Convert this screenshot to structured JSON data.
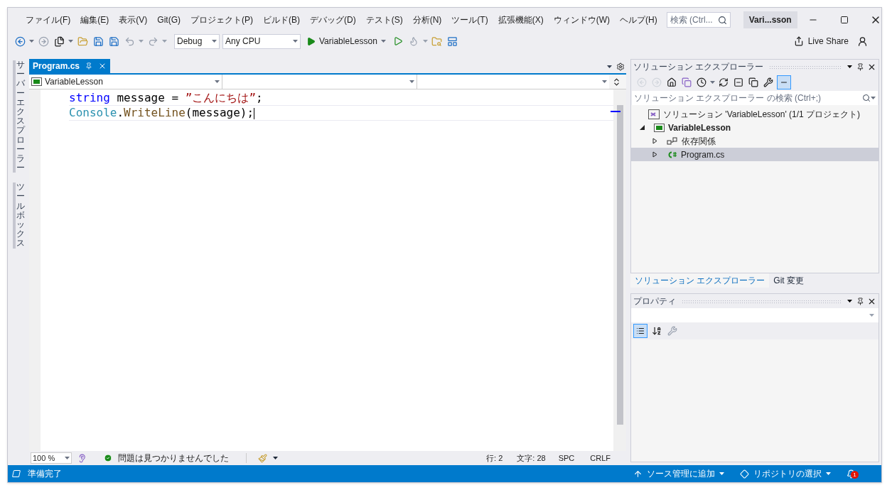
{
  "menu": [
    "ファイル(F)",
    "編集(E)",
    "表示(V)",
    "Git(G)",
    "プロジェクト(P)",
    "ビルド(B)",
    "デバッグ(D)",
    "テスト(S)",
    "分析(N)",
    "ツール(T)",
    "拡張機能(X)",
    "ウィンドウ(W)",
    "ヘルプ(H)"
  ],
  "search": {
    "placeholder": "検索 (Ctrl..."
  },
  "solution_badge": "Vari...sson",
  "toolbar": {
    "configuration": "Debug",
    "platform": "Any CPU",
    "run_target": "VariableLesson"
  },
  "live_share": "Live Share",
  "side_tabs": [
    "サーバーエクスプローラー",
    "ツールボックス"
  ],
  "editor": {
    "tabs": [
      {
        "label": "Program.cs",
        "selected": true
      }
    ],
    "nav_project": "VariableLesson",
    "lines": [
      [
        {
          "kind": "keyword",
          "text": "string"
        },
        {
          "kind": "plain",
          "text": " message = "
        },
        {
          "kind": "string",
          "text": "”こんにちは”"
        },
        {
          "kind": "plain",
          "text": ";"
        }
      ],
      [
        {
          "kind": "type",
          "text": "Console"
        },
        {
          "kind": "plain",
          "text": "."
        },
        {
          "kind": "method",
          "text": "WriteLine"
        },
        {
          "kind": "plain",
          "text": "(message);"
        }
      ]
    ],
    "zoom": "100 %",
    "issues": "問題は見つかりませんでした",
    "line": "行: 2",
    "column": "文字: 28",
    "indent": "SPC",
    "eol": "CRLF"
  },
  "solution_explorer": {
    "title": "ソリューション エクスプローラー",
    "search_placeholder": "ソリューション エクスプローラー の検索 (Ctrl+;)",
    "tree": [
      {
        "label": "ソリューション 'VariableLesson' (1/1 プロジェクト)",
        "kind": "solution",
        "selected": false,
        "children": [
          {
            "label": "VariableLesson",
            "kind": "project",
            "expanded": true,
            "selected": false,
            "children": [
              {
                "label": "依存関係",
                "kind": "dependencies",
                "expanded": false,
                "selected": false
              },
              {
                "label": "Program.cs",
                "kind": "csharp",
                "expanded": false,
                "selected": true
              }
            ]
          }
        ]
      }
    ]
  },
  "panel_tabs": [
    {
      "label": "ソリューション エクスプローラー",
      "selected": true
    },
    {
      "label": "Git 変更",
      "selected": false
    }
  ],
  "properties": {
    "title": "プロパティ"
  },
  "status_bar": {
    "text": "準備完了",
    "source_control": "ソース管理に追加",
    "repository": "リポジトリの選択",
    "notifications": "1"
  }
}
